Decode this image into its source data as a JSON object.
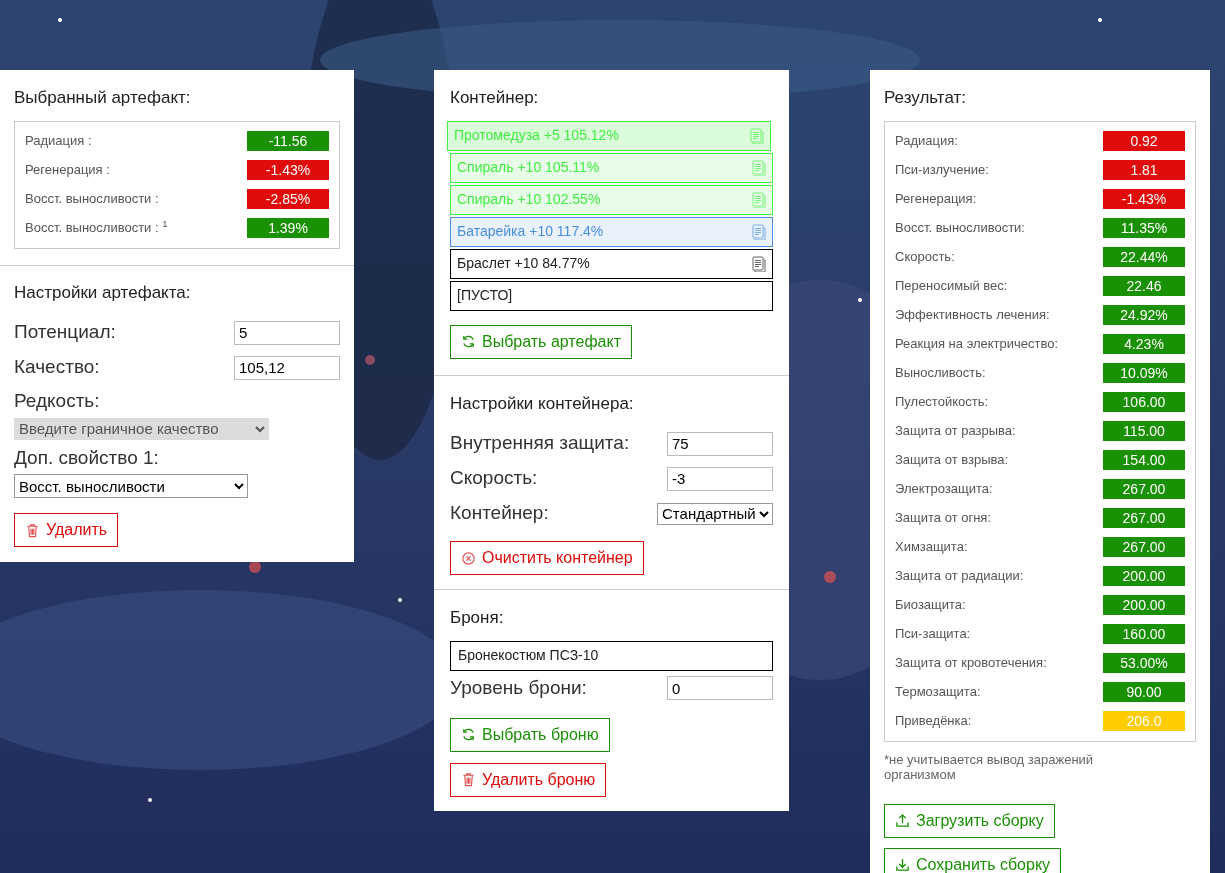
{
  "artifact": {
    "title": "Выбранный артефакт:",
    "stats": [
      {
        "label": "Радиация :",
        "value": "-11.56",
        "color": "#1a9104"
      },
      {
        "label": "Регенерация :",
        "value": "-1.43%",
        "color": "#e00b0b"
      },
      {
        "label": "Восст. выносливости :",
        "value": "-2.85%",
        "color": "#e00b0b"
      },
      {
        "label": "Восст. выносливости : $^{1}$",
        "value": "1.39%",
        "color": "#1a9104"
      }
    ]
  },
  "artifact_settings": {
    "title": "Настройки артефакта:",
    "fields": [
      {
        "label": "Потенциал:",
        "value": "5"
      },
      {
        "label": "Качество:",
        "value": "105,12"
      }
    ],
    "rarity": {
      "label": "Редкость:",
      "value": "Введите граничное качество",
      "disabled": true
    },
    "extra": {
      "label": "Доп. свойство 1:",
      "value": "Восст. выносливости",
      "disabled": false
    },
    "delete_button": "Удалить"
  },
  "container": {
    "title": "Контейнер:",
    "slots": [
      {
        "kind": "artifact",
        "text": "Протомедуза +5 105.12%",
        "color": "#44ee44",
        "selected": true
      },
      {
        "kind": "artifact",
        "text": "Спираль +10 105.11%",
        "color": "#44ee44",
        "selected": false
      },
      {
        "kind": "artifact",
        "text": "Спираль +10 102.55%",
        "color": "#44ee44",
        "selected": false
      },
      {
        "kind": "artifact",
        "text": "Батарейка +10 117.4%",
        "color": "#4a8ee0",
        "selected": false
      },
      {
        "kind": "artifact",
        "text": "Браслет +10 84.77%",
        "color": "#000000",
        "selected": false
      },
      {
        "kind": "empty",
        "text": "[ПУСТО]",
        "color": "#000000",
        "selected": false
      }
    ],
    "choose_button": "Выбрать артефакт"
  },
  "container_settings": {
    "title": "Настройки контейнера:",
    "fields": [
      {
        "label": "Внутренняя защита:",
        "value": "75"
      },
      {
        "label": "Скорость:",
        "value": "-3"
      }
    ],
    "type": {
      "label": "Контейнер:",
      "value": "Стандартный"
    },
    "clear_button": "Очистить контейнер"
  },
  "armor": {
    "title": "Броня:",
    "name": "Бронекостюм ПСЗ-10",
    "level": {
      "label": "Уровень брони:",
      "value": "0"
    },
    "choose_button": "Выбрать броню",
    "delete_button": "Удалить броню"
  },
  "result": {
    "title": "Результат:",
    "stats": [
      {
        "label": "Радиация:",
        "value": "0.92",
        "color": "#e00b0b"
      },
      {
        "label": "Пси-излучение:",
        "value": "1.81",
        "color": "#e00b0b"
      },
      {
        "label": "Регенерация:",
        "value": "-1.43%",
        "color": "#e00b0b"
      },
      {
        "label": "Восст. выносливости:",
        "value": "11.35%",
        "color": "#1a9104"
      },
      {
        "label": "Скорость:",
        "value": "22.44%",
        "color": "#1a9104"
      },
      {
        "label": "Переносимый вес:",
        "value": "22.46",
        "color": "#1a9104"
      },
      {
        "label": "Эффективность лечения:",
        "value": "24.92%",
        "color": "#1a9104"
      },
      {
        "label": "Реакция на электричество:",
        "value": "4.23%",
        "color": "#1a9104"
      },
      {
        "label": "Выносливость:",
        "value": "10.09%",
        "color": "#1a9104"
      },
      {
        "label": "Пулестойкость:",
        "value": "106.00",
        "color": "#1a9104"
      },
      {
        "label": "Защита от разрыва:",
        "value": "115.00",
        "color": "#1a9104"
      },
      {
        "label": "Защита от взрыва:",
        "value": "154.00",
        "color": "#1a9104"
      },
      {
        "label": "Электрозащита:",
        "value": "267.00",
        "color": "#1a9104"
      },
      {
        "label": "Защита от огня:",
        "value": "267.00",
        "color": "#1a9104"
      },
      {
        "label": "Химзащита:",
        "value": "267.00",
        "color": "#1a9104"
      },
      {
        "label": "Защита от радиации:",
        "value": "200.00",
        "color": "#1a9104"
      },
      {
        "label": "Биозащита:",
        "value": "200.00",
        "color": "#1a9104"
      },
      {
        "label": "Пси-защита:",
        "value": "160.00",
        "color": "#1a9104"
      },
      {
        "label": "Защита от кровотечения:",
        "value": "53.00%",
        "color": "#1a9104"
      },
      {
        "label": "Термозащита:",
        "value": "90.00",
        "color": "#1a9104"
      },
      {
        "label": "Приведёнка:",
        "value": "206.0",
        "color": "#ffcc00"
      }
    ],
    "note": "*не учитывается вывод заражений организмом",
    "load_button": "Загрузить сборку",
    "save_button": "Сохранить сборку"
  }
}
